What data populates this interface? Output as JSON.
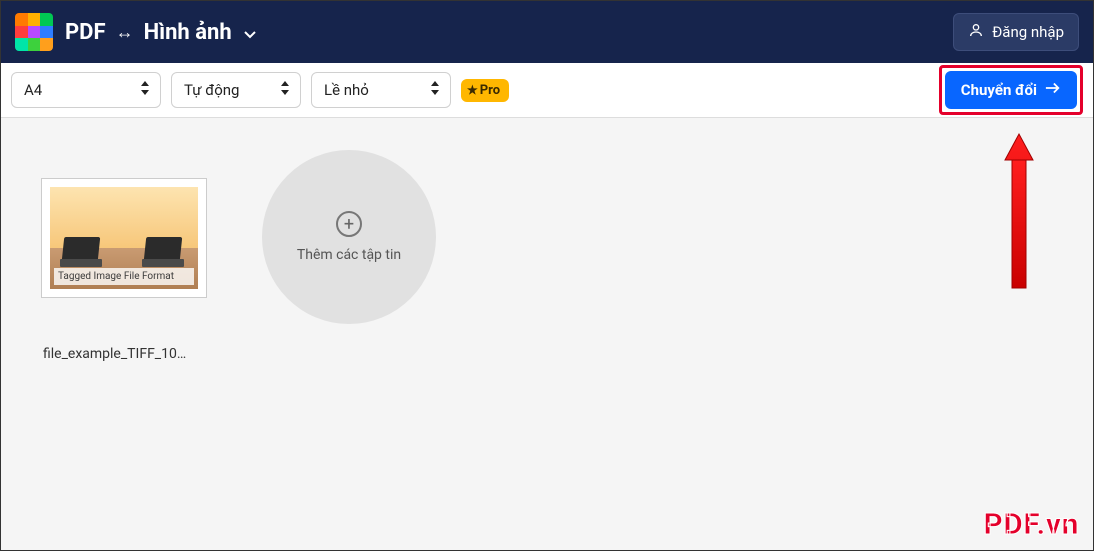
{
  "header": {
    "title_left": "PDF",
    "title_right": "Hình ảnh",
    "login_label": "Đăng nhập"
  },
  "logo_colors": [
    "#ff7a00",
    "#ffb000",
    "#00c853",
    "#ff3d3d",
    "#b84aff",
    "#2e7dff",
    "#00e5a8",
    "#3dd13d",
    "#ff9f1c"
  ],
  "toolbar": {
    "page_size": "A4",
    "orientation": "Tự động",
    "margin": "Lề nhỏ",
    "pro_label": "Pro",
    "convert_label": "Chuyển đổi"
  },
  "file": {
    "thumb_caption": "Tagged Image File Format",
    "name": "file_example_TIFF_10…"
  },
  "add_more_label": "Thêm các tập tin",
  "watermark": "PDF.vn"
}
